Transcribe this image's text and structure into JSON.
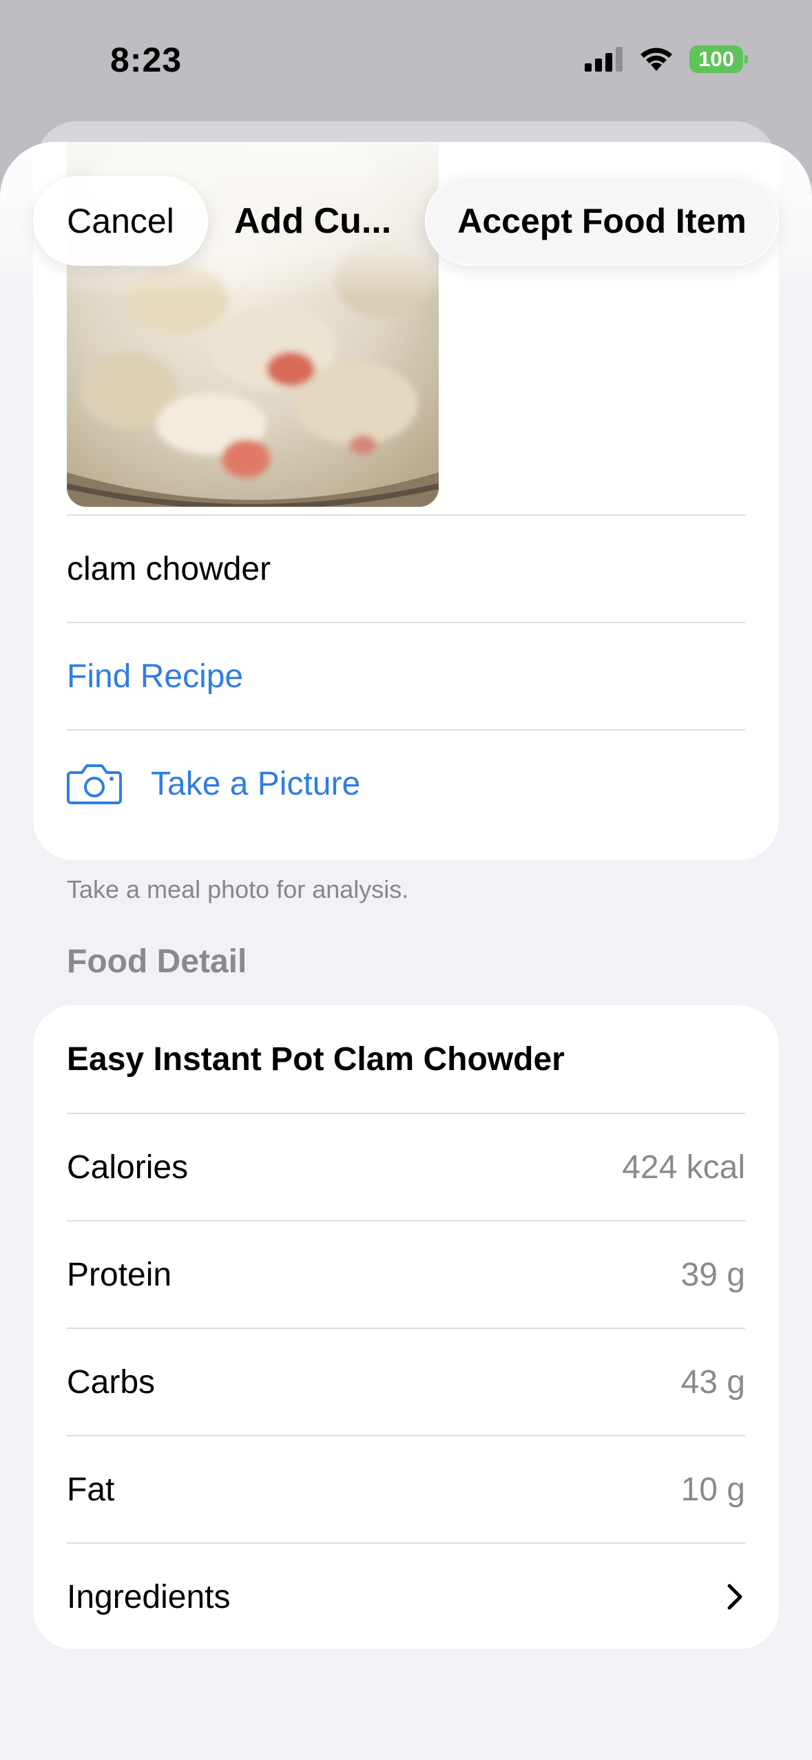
{
  "status": {
    "time": "8:23",
    "battery": "100",
    "icons": [
      "cellular-signal-icon",
      "wifi-icon",
      "battery-icon"
    ]
  },
  "nav": {
    "cancel_label": "Cancel",
    "title": "Add Cu...",
    "accept_label": "Accept Food Item"
  },
  "entry": {
    "food_name": "clam chowder",
    "find_recipe_label": "Find Recipe",
    "take_picture_label": "Take a Picture",
    "footnote": "Take a meal photo for analysis."
  },
  "food_detail": {
    "section_header": "Food Detail",
    "title": "Easy Instant Pot Clam Chowder",
    "rows": [
      {
        "label": "Calories",
        "value": "424 kcal"
      },
      {
        "label": "Protein",
        "value": "39 g"
      },
      {
        "label": "Carbs",
        "value": "43 g"
      },
      {
        "label": "Fat",
        "value": "10 g"
      }
    ],
    "ingredients_label": "Ingredients"
  },
  "colors": {
    "accent": "#2f7de1",
    "battery": "#5ec45a",
    "background": "#f1f1f6"
  }
}
